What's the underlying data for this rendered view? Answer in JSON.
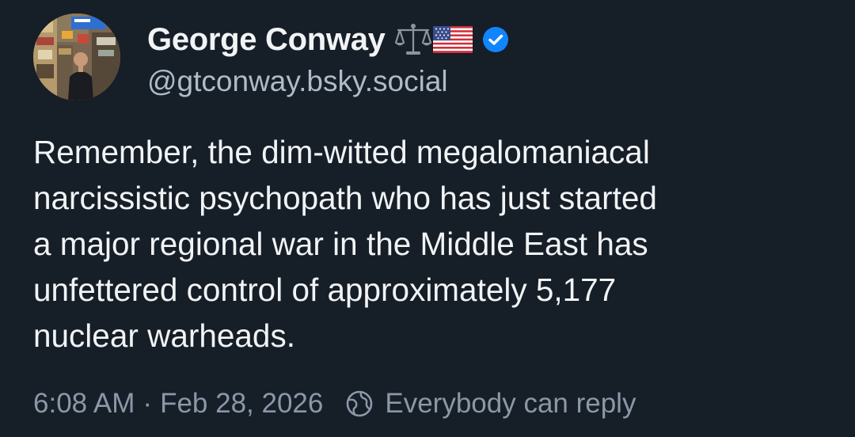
{
  "author": {
    "display_name": "George Conway",
    "handle": "@gtconway.bsky.social",
    "badges": [
      "scales-icon",
      "us-flag-icon",
      "verified-icon"
    ]
  },
  "post": {
    "lines": [
      "Remember, the dim-witted megalomaniacal",
      "narcissistic psychopath who has just started",
      "a major regional war in the Middle East has",
      "unfettered control of approximately 5,177",
      "nuclear warheads."
    ]
  },
  "meta": {
    "time": "6:08 AM",
    "separator": "·",
    "date": "Feb 28, 2026",
    "reply_setting": "Everybody can reply",
    "reply_icon": "globe-icon"
  },
  "colors": {
    "background": "#161e27",
    "text_primary": "#f1f3f5",
    "text_secondary": "#aebbc9",
    "text_meta": "#8a98a8",
    "verified_blue": "#1185fe"
  }
}
